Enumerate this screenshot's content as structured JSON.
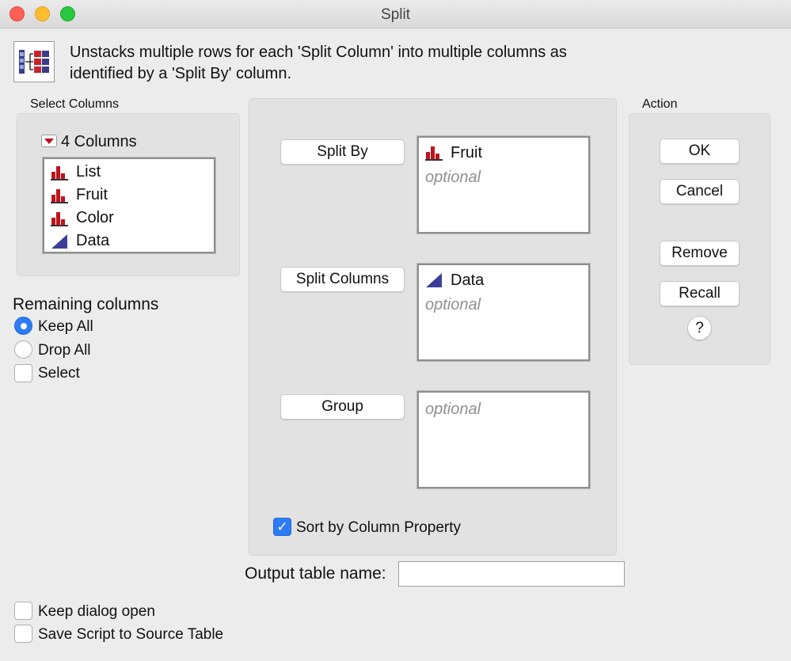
{
  "window": {
    "title": "Split"
  },
  "description": "Unstacks multiple rows for each 'Split Column' into multiple columns as identified by a 'Split By' column.",
  "select_columns": {
    "label": "Select Columns",
    "count_label": "4 Columns",
    "items": [
      {
        "label": "List",
        "type": "nominal"
      },
      {
        "label": "Fruit",
        "type": "nominal"
      },
      {
        "label": "Color",
        "type": "nominal"
      },
      {
        "label": "Data",
        "type": "continuous"
      }
    ]
  },
  "remaining_columns": {
    "label": "Remaining columns",
    "options": [
      {
        "label": "Keep All",
        "selected": true
      },
      {
        "label": "Drop All",
        "selected": false
      }
    ],
    "select_label": "Select"
  },
  "roles": {
    "split_by": {
      "button": "Split By",
      "item": "Fruit",
      "placeholder": "optional"
    },
    "split_columns": {
      "button": "Split Columns",
      "item": "Data",
      "placeholder": "optional"
    },
    "group": {
      "button": "Group",
      "placeholder": "optional"
    },
    "sort_label": "Sort by Column Property"
  },
  "action": {
    "label": "Action",
    "ok": "OK",
    "cancel": "Cancel",
    "remove": "Remove",
    "recall": "Recall",
    "help": "?"
  },
  "output": {
    "label": "Output table name:",
    "value": ""
  },
  "footer": {
    "keep_open": "Keep dialog open",
    "save_script": "Save Script to Source Table"
  },
  "colors": {
    "accent": "#2d7cf6",
    "nominal_icon": "#c0131b",
    "continuous_icon": "#3b3f99"
  }
}
